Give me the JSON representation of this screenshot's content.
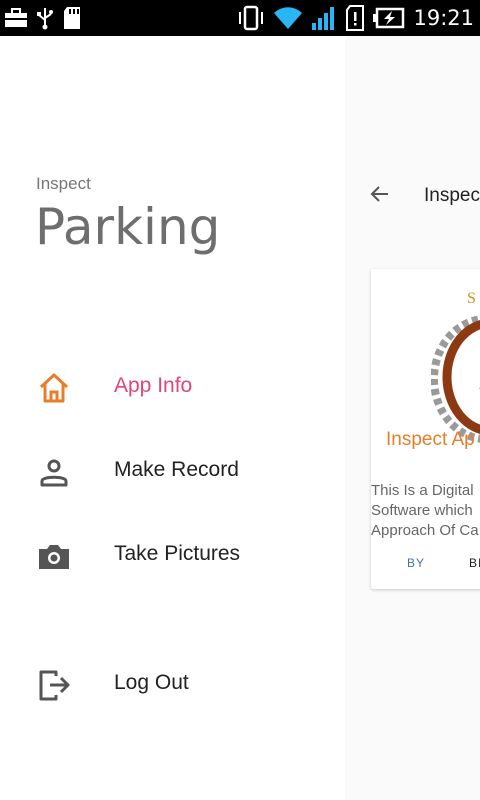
{
  "status_bar": {
    "time": "19:21"
  },
  "drawer": {
    "subtitle": "Inspect",
    "title": "Parking",
    "items": [
      {
        "label": "App Info",
        "icon": "home-icon",
        "active": true
      },
      {
        "label": "Make Record",
        "icon": "person-icon",
        "active": false
      },
      {
        "label": "Take Pictures",
        "icon": "camera-icon",
        "active": false
      },
      {
        "label": "Log Out",
        "icon": "logout-icon",
        "active": false
      }
    ]
  },
  "background_page": {
    "title": "Inspec",
    "card": {
      "logo_text": "Inspect Ap",
      "description": "This Is a Digital\nSoftware which\nApproach Of Ca",
      "action_1": "BY",
      "action_2": "BI"
    }
  },
  "colors": {
    "accent": "#e2457a",
    "icon_active": "#e87d2a",
    "icon": "#555555"
  }
}
